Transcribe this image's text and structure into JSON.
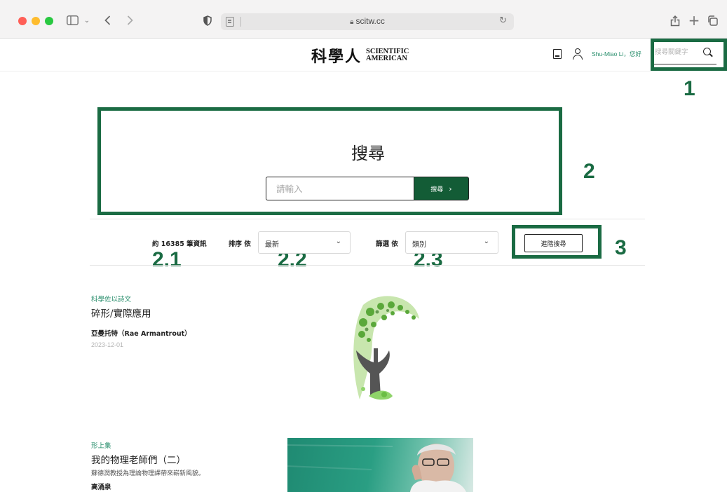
{
  "browser": {
    "url": "scitw.cc"
  },
  "header": {
    "logo_cn": "科學人",
    "logo_en_line1": "SCIENTIFIC",
    "logo_en_line2": "AMERICAN",
    "greeting": "Shu-Miao Li，您好",
    "search_placeholder": "搜尋關鍵字"
  },
  "search": {
    "title": "搜尋",
    "input_placeholder": "請輸入",
    "button_label": "搜尋",
    "button_chevron": "›"
  },
  "filters": {
    "result_count": "約 16385 筆資訊",
    "sort_label": "排序 依",
    "sort_value": "最新",
    "filter_label": "篩選 依",
    "filter_value": "類別",
    "advanced_label": "進階搜尋"
  },
  "annotations": {
    "n1": "1",
    "n2": "2",
    "n3": "3",
    "n21": "2.1",
    "n22": "2.2",
    "n23": "2.3"
  },
  "articles": [
    {
      "category": "科學佐以詩文",
      "title": "碎形/實際應用",
      "author": "亞曼托特（Rae Armantrout）",
      "date": "2023-12-01"
    },
    {
      "category": "形上集",
      "title": "我的物理老師們（二）",
      "summary": "蘇德潤教授為理論物理課帶來嶄新風貌。",
      "author": "高涌泉"
    }
  ],
  "colors": {
    "brand_green": "#135c36",
    "annotation_green": "#1a6b43",
    "category_green": "#2a8f6d"
  }
}
